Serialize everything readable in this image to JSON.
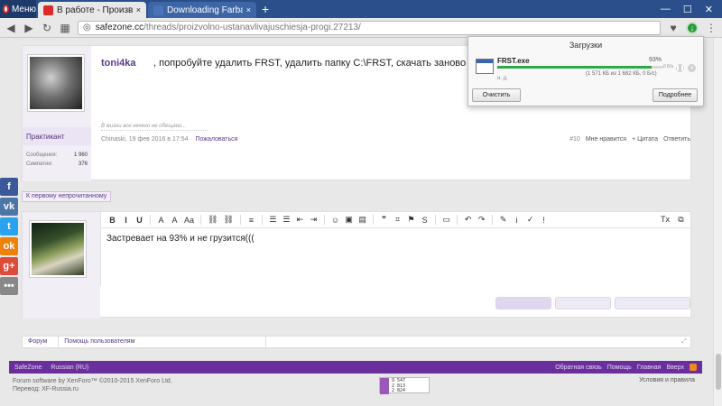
{
  "browser": {
    "menu_label": "Меню",
    "tabs": [
      {
        "title": "В работе - Произвольно уст",
        "close": "×",
        "active": true,
        "favicon_color": "#e02a2a"
      },
      {
        "title": "Downloading Farbar Recove",
        "close": "×",
        "active": false,
        "favicon_color": "#4a73b8"
      }
    ],
    "newtab": "+",
    "window_controls": {
      "minimize": "—",
      "maximize": "☐",
      "close": "✕"
    },
    "address": {
      "host": "safezone.cc",
      "path": "/threads/proizvolno-ustanavlivajuschiesja-progi.27213/"
    }
  },
  "downloads": {
    "title": "Загрузки",
    "file_name": "FRST.exe",
    "percent_label": "93%",
    "progress": 0.93,
    "speed": "0 B/s",
    "detail": "(1 571 КБ из 1 682 КБ, 0 Б/с)",
    "status": "н. д.",
    "clear_button": "Очистить",
    "details_button": "Подробнее"
  },
  "post": {
    "author": "toni4ka",
    "text": ", попробуйте удалить FRST, удалить папку C:\\FRST, скачать заново и запустить.",
    "rank": "Практикант",
    "stats": [
      {
        "label": "Сообщения:",
        "value": "1 960"
      },
      {
        "label": "Симпатии:",
        "value": "376"
      }
    ],
    "signature": "В жизни все нечего не обещано...",
    "meta_author": "Chinaski, 19 фев 2016 в 17:54",
    "report": "Пожаловаться",
    "actions": {
      "number": "#10",
      "like": "Мне нравится",
      "quote": "+ Цитата",
      "reply": "Ответить"
    }
  },
  "share_buttons": [
    {
      "name": "facebook",
      "glyph": "f",
      "color": "#3b5998"
    },
    {
      "name": "vkontakte",
      "glyph": "vk",
      "color": "#4a76a8"
    },
    {
      "name": "twitter",
      "glyph": "t",
      "color": "#2aa3ef"
    },
    {
      "name": "odnoklassniki",
      "glyph": "ok",
      "color": "#ee8208"
    },
    {
      "name": "googleplus",
      "glyph": "g+",
      "color": "#dd4b39"
    },
    {
      "name": "more",
      "glyph": "•••",
      "color": "#888888"
    }
  ],
  "unread_link": "К первому непрочитанному",
  "reply": {
    "toolbar": [
      "B",
      "I",
      "U",
      "A",
      "A",
      "Aa",
      "⛓",
      "⛓",
      "≡",
      "☰",
      "☰",
      "⇤",
      "⇥",
      "☺",
      "▣",
      "▤",
      "❞",
      "⌗",
      "⚑",
      "S",
      "▭",
      "↶",
      "↷",
      "✎",
      "i",
      "✓",
      "!"
    ],
    "toolbar_right": [
      "Tx",
      "⧉"
    ],
    "text": "Застревает на 93% и не грузится((("
  },
  "breadcrumbs": [
    "Форум",
    "Помощь пользователям"
  ],
  "footer": {
    "left": [
      "SafeZone",
      "Russian (RU)"
    ],
    "right": [
      "Обратная связь",
      "Помощь",
      "Главная",
      "Вверх"
    ],
    "copyright": "Forum software by XenForo™ ©2010-2015 XenForo Ltd.",
    "translation": "Перевод: XF-Russia.ru",
    "terms": "Условия и правила",
    "counter": [
      "9 547",
      "2 813",
      "2 824"
    ]
  }
}
